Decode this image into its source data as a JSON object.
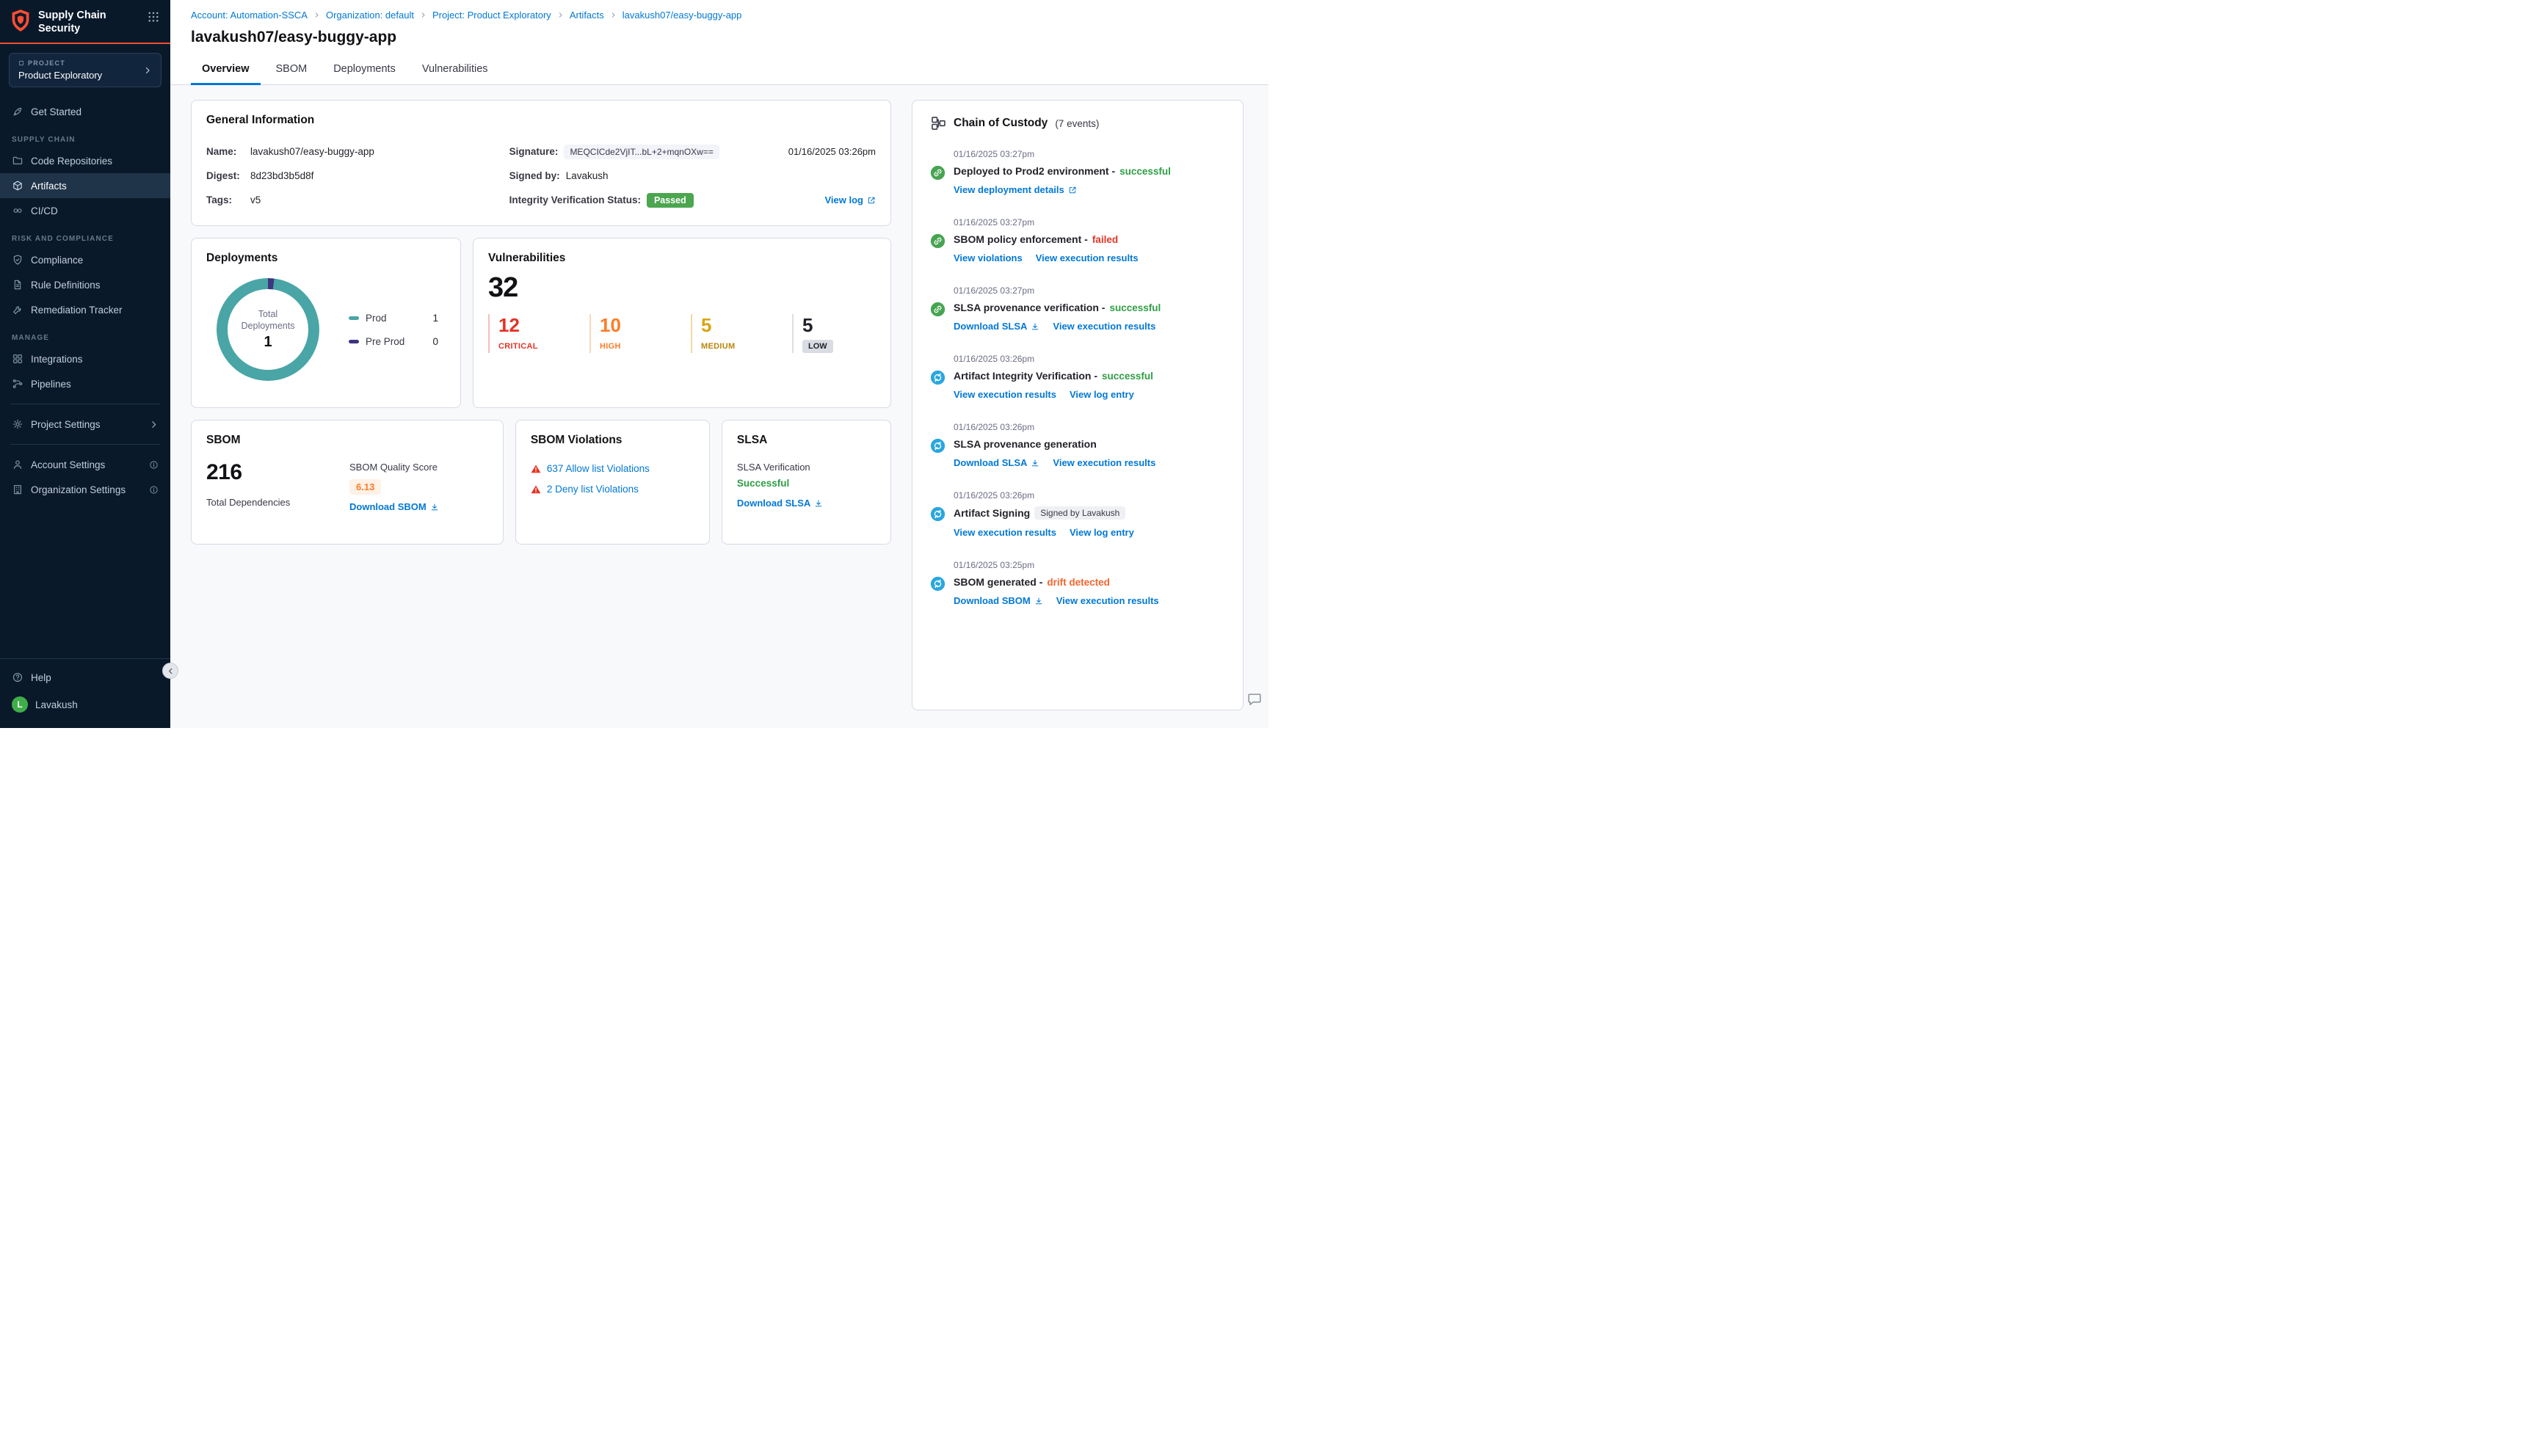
{
  "colors": {
    "accent_blue": "#0278d5",
    "brand_orange": "#ff4e33",
    "success_green": "#2f9e44",
    "critical_red": "#e43326",
    "high_orange": "#ff7b26",
    "medium_amber": "#d9a514",
    "donut_teal": "#4aa5a6",
    "donut_purple": "#3d3580",
    "sidebar_bg": "#0a192a"
  },
  "icons": {
    "shield-logo": "orange shield",
    "grid-icon": "3x3 dots app switcher",
    "chevron": "›",
    "external-link": "box with arrow",
    "download": "arrow into tray",
    "warning-triangle": "red triangle with !",
    "event-green": "green circle link",
    "event-blue": "blue circle sync",
    "chain-of-custody": "hierarchy boxes",
    "info": "circled i",
    "chat": "speech bubble"
  },
  "sidebar": {
    "logo_title": "Supply Chain Security",
    "project_label": "PROJECT",
    "project_name": "Product Exploratory",
    "sections": {
      "supply_chain": "SUPPLY CHAIN",
      "risk_compliance": "RISK AND COMPLIANCE",
      "manage": "MANAGE"
    },
    "items": {
      "get_started": "Get Started",
      "code_repositories": "Code Repositories",
      "artifacts": "Artifacts",
      "cicd": "CI/CD",
      "compliance": "Compliance",
      "rule_definitions": "Rule Definitions",
      "remediation_tracker": "Remediation Tracker",
      "integrations": "Integrations",
      "pipelines": "Pipelines",
      "project_settings": "Project Settings",
      "account_settings": "Account Settings",
      "organization_settings": "Organization Settings",
      "help": "Help"
    },
    "user": {
      "initial": "L",
      "name": "Lavakush"
    }
  },
  "header": {
    "breadcrumb": [
      "Account: Automation-SSCA",
      "Organization: default",
      "Project: Product Exploratory",
      "Artifacts",
      "lavakush07/easy-buggy-app"
    ],
    "title": "lavakush07/easy-buggy-app",
    "tabs": [
      "Overview",
      "SBOM",
      "Deployments",
      "Vulnerabilities"
    ],
    "active_tab": "Overview"
  },
  "general_info": {
    "title": "General Information",
    "name_label": "Name:",
    "name": "lavakush07/easy-buggy-app",
    "digest_label": "Digest:",
    "digest": "8d23bd3b5d8f",
    "tags_label": "Tags:",
    "tags": "v5",
    "signature_label": "Signature:",
    "signature": "MEQCICde2VjIT...bL+2+mqnOXw==",
    "signature_time": "01/16/2025 03:26pm",
    "signed_by_label": "Signed by:",
    "signed_by": "Lavakush",
    "integrity_label": "Integrity Verification Status:",
    "integrity_status": "Passed",
    "view_log": "View log"
  },
  "deployments": {
    "title": "Deployments",
    "center_label_line1": "Total",
    "center_label_line2": "Deployments",
    "total": "1",
    "legend": [
      {
        "name": "Prod",
        "value": "1"
      },
      {
        "name": "Pre Prod",
        "value": "0"
      }
    ]
  },
  "vulnerabilities": {
    "title": "Vulnerabilities",
    "total": "32",
    "severities": [
      {
        "count": "12",
        "label": "CRITICAL"
      },
      {
        "count": "10",
        "label": "HIGH"
      },
      {
        "count": "5",
        "label": "MEDIUM"
      },
      {
        "count": "5",
        "label": "LOW"
      }
    ]
  },
  "sbom": {
    "title": "SBOM",
    "total": "216",
    "total_label": "Total Dependencies",
    "quality_label": "SBOM Quality Score",
    "quality_score": "6.13",
    "download_label": "Download SBOM"
  },
  "sbom_violations": {
    "title": "SBOM Violations",
    "allow": "637 Allow list Violations",
    "deny": "2 Deny list Violations"
  },
  "slsa": {
    "title": "SLSA",
    "verification_label": "SLSA Verification",
    "status": "Successful",
    "download_label": "Download SLSA"
  },
  "chain_of_custody": {
    "title": "Chain of Custody",
    "count": "(7 events)",
    "events": [
      {
        "time": "01/16/2025 03:27pm",
        "title": "Deployed to Prod2 environment -",
        "status": "successful",
        "links": [
          {
            "label": "View deployment details"
          }
        ]
      },
      {
        "time": "01/16/2025 03:27pm",
        "title": "SBOM policy enforcement -",
        "status": "failed",
        "links": [
          {
            "label": "View violations"
          },
          {
            "label": "View execution results"
          }
        ]
      },
      {
        "time": "01/16/2025 03:27pm",
        "title": "SLSA provenance verification -",
        "status": "successful",
        "links": [
          {
            "label": "Download SLSA"
          },
          {
            "label": "View execution results"
          }
        ]
      },
      {
        "time": "01/16/2025 03:26pm",
        "title": "Artifact Integrity Verification -",
        "status": "successful",
        "links": [
          {
            "label": "View execution results"
          },
          {
            "label": "View log entry"
          }
        ]
      },
      {
        "time": "01/16/2025 03:26pm",
        "title": "SLSA provenance generation",
        "links": [
          {
            "label": "Download SLSA"
          },
          {
            "label": "View execution results"
          }
        ]
      },
      {
        "time": "01/16/2025 03:26pm",
        "title": "Artifact Signing",
        "badge": "Signed by Lavakush",
        "links": [
          {
            "label": "View execution results"
          },
          {
            "label": "View log entry"
          }
        ]
      },
      {
        "time": "01/16/2025 03:25pm",
        "title": "SBOM generated -",
        "status": "drift detected",
        "links": [
          {
            "label": "Download SBOM"
          },
          {
            "label": "View execution results"
          }
        ]
      }
    ]
  }
}
